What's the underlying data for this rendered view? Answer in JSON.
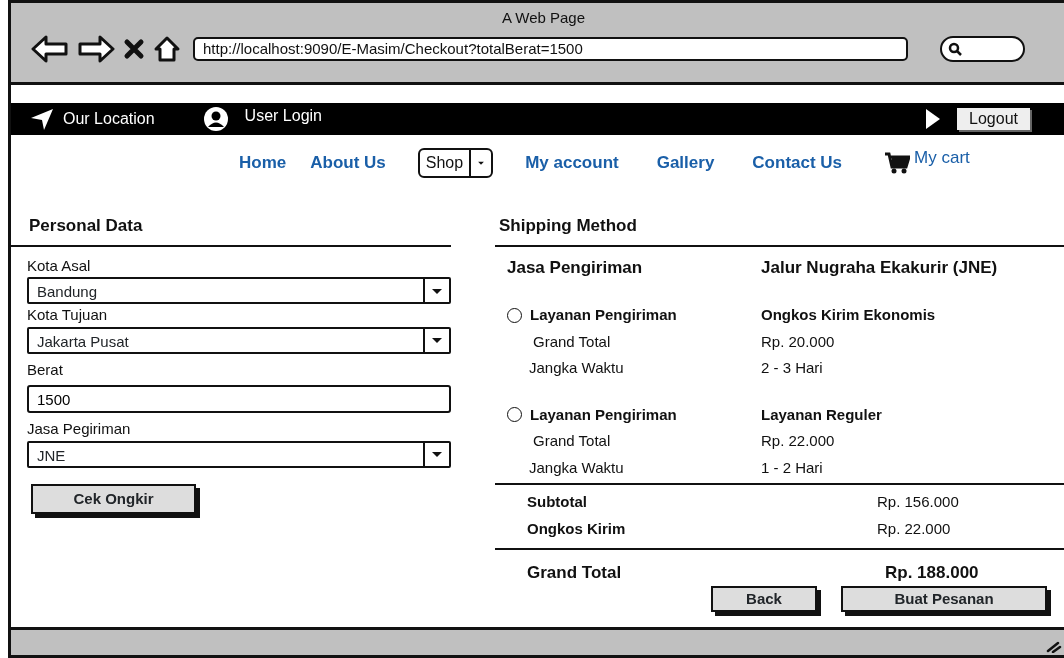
{
  "window": {
    "title": "A Web Page",
    "url": "http://localhost:9090/E-Masim/Checkout?totalBerat=1500"
  },
  "topbar": {
    "location": "Our Location",
    "login": "User Login",
    "logout": "Logout"
  },
  "nav": {
    "items": [
      {
        "label": "Home",
        "kind": "link"
      },
      {
        "label": "About Us",
        "kind": "link"
      },
      {
        "label": "Shop",
        "kind": "dropdown"
      },
      {
        "label": "My account",
        "kind": "link"
      },
      {
        "label": "Gallery",
        "kind": "link"
      },
      {
        "label": "Contact Us",
        "kind": "link"
      }
    ],
    "cart": "My cart"
  },
  "personal_data": {
    "title": "Personal Data",
    "fields": [
      {
        "label": "Kota Asal",
        "kind": "select",
        "value": "Bandung"
      },
      {
        "label": "Kota Tujuan",
        "kind": "select",
        "value": "Jakarta Pusat"
      },
      {
        "label": "Berat",
        "kind": "text",
        "value": "1500"
      },
      {
        "label": "Jasa Pegiriman",
        "kind": "select",
        "value": "JNE"
      }
    ],
    "button": "Cek Ongkir"
  },
  "shipping": {
    "title": "Shipping Method",
    "courier_label": "Jasa Pengiriman",
    "courier_name": "Jalur Nugraha Ekakurir (JNE)",
    "options": [
      {
        "label": "Layanan Pengiriman",
        "selected": false,
        "service": "Ongkos Kirim Ekonomis",
        "total_label": "Grand Total",
        "total": "Rp. 20.000",
        "duration_label": "Jangka Waktu",
        "duration": "2 - 3 Hari"
      },
      {
        "label": "Layanan Pengiriman",
        "selected": false,
        "service": "Layanan Reguler",
        "total_label": "Grand Total",
        "total": "Rp. 22.000",
        "duration_label": "Jangka Waktu",
        "duration": "1 - 2 Hari"
      }
    ],
    "summary": [
      {
        "label": "Subtotal",
        "value": "Rp. 156.000"
      },
      {
        "label": "Ongkos Kirim",
        "value": "Rp. 22.000"
      }
    ],
    "grand_total": {
      "label": "Grand Total",
      "value": "Rp. 188.000"
    },
    "buttons": [
      "Back",
      "Buat Pesanan"
    ]
  }
}
